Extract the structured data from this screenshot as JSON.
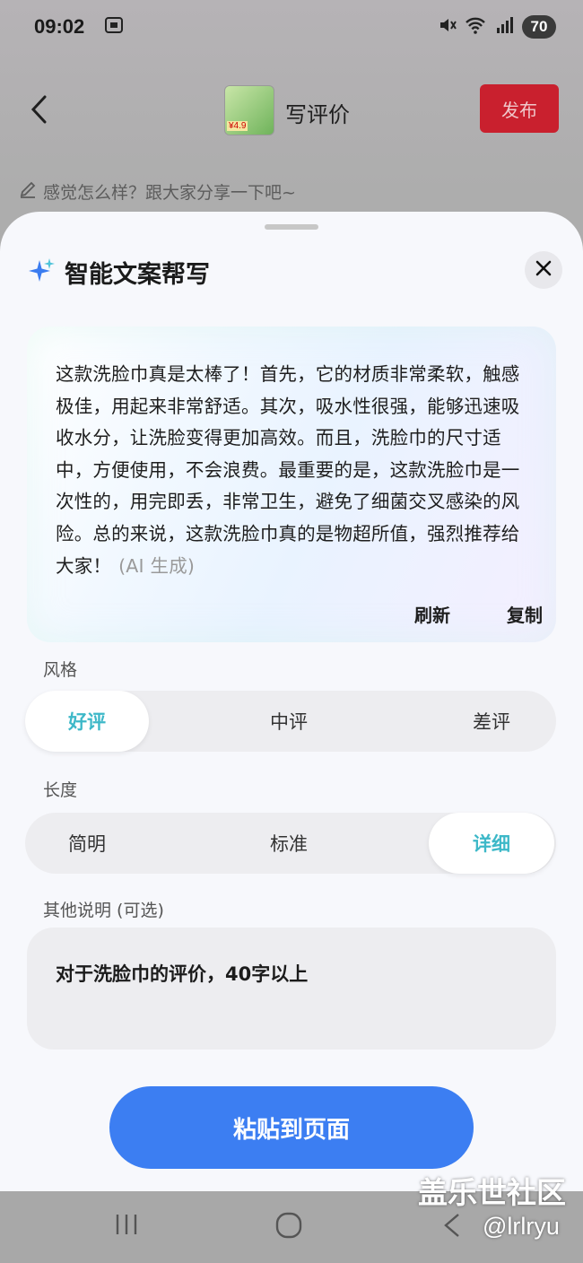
{
  "status_bar": {
    "time": "09:02",
    "battery": "70",
    "icons": [
      "screenshot-icon",
      "mute-icon",
      "wifi-icon",
      "signal-5g-icon"
    ]
  },
  "header": {
    "title": "写评价",
    "publish_label": "发布",
    "product_price_tag": "¥4.9"
  },
  "review_input": {
    "placeholder": "感觉怎么样？跟大家分享一下吧~"
  },
  "sheet": {
    "title": "智能文案帮写",
    "generated_text": "这款洗脸巾真是太棒了！首先，它的材质非常柔软，触感极佳，用起来非常舒适。其次，吸水性很强，能够迅速吸收水分，让洗脸变得更加高效。而且，洗脸巾的尺寸适中，方便使用，不会浪费。最重要的是，这款洗脸巾是一次性的，用完即丢，非常卫生，避免了细菌交叉感染的风险。总的来说，这款洗脸巾真的是物超所值，强烈推荐给大家！",
    "ai_tag": "(AI 生成)",
    "refresh_label": "刷新",
    "copy_label": "复制",
    "style_label": "风格",
    "style_options": [
      "好评",
      "中评",
      "差评"
    ],
    "style_selected": "好评",
    "length_label": "长度",
    "length_options": [
      "简明",
      "标准",
      "详细"
    ],
    "length_selected": "详细",
    "notes_label": "其他说明 (可选)",
    "notes_value": "对于洗脸巾的评价，40字以上",
    "paste_button": "粘贴到页面"
  },
  "watermark": {
    "line1": "盖乐世社区",
    "line2": "@lrlryu"
  },
  "colors": {
    "accent_blue": "#3c7ef2",
    "publish_red": "#c9202e",
    "selected_teal": "#3db8c8"
  }
}
